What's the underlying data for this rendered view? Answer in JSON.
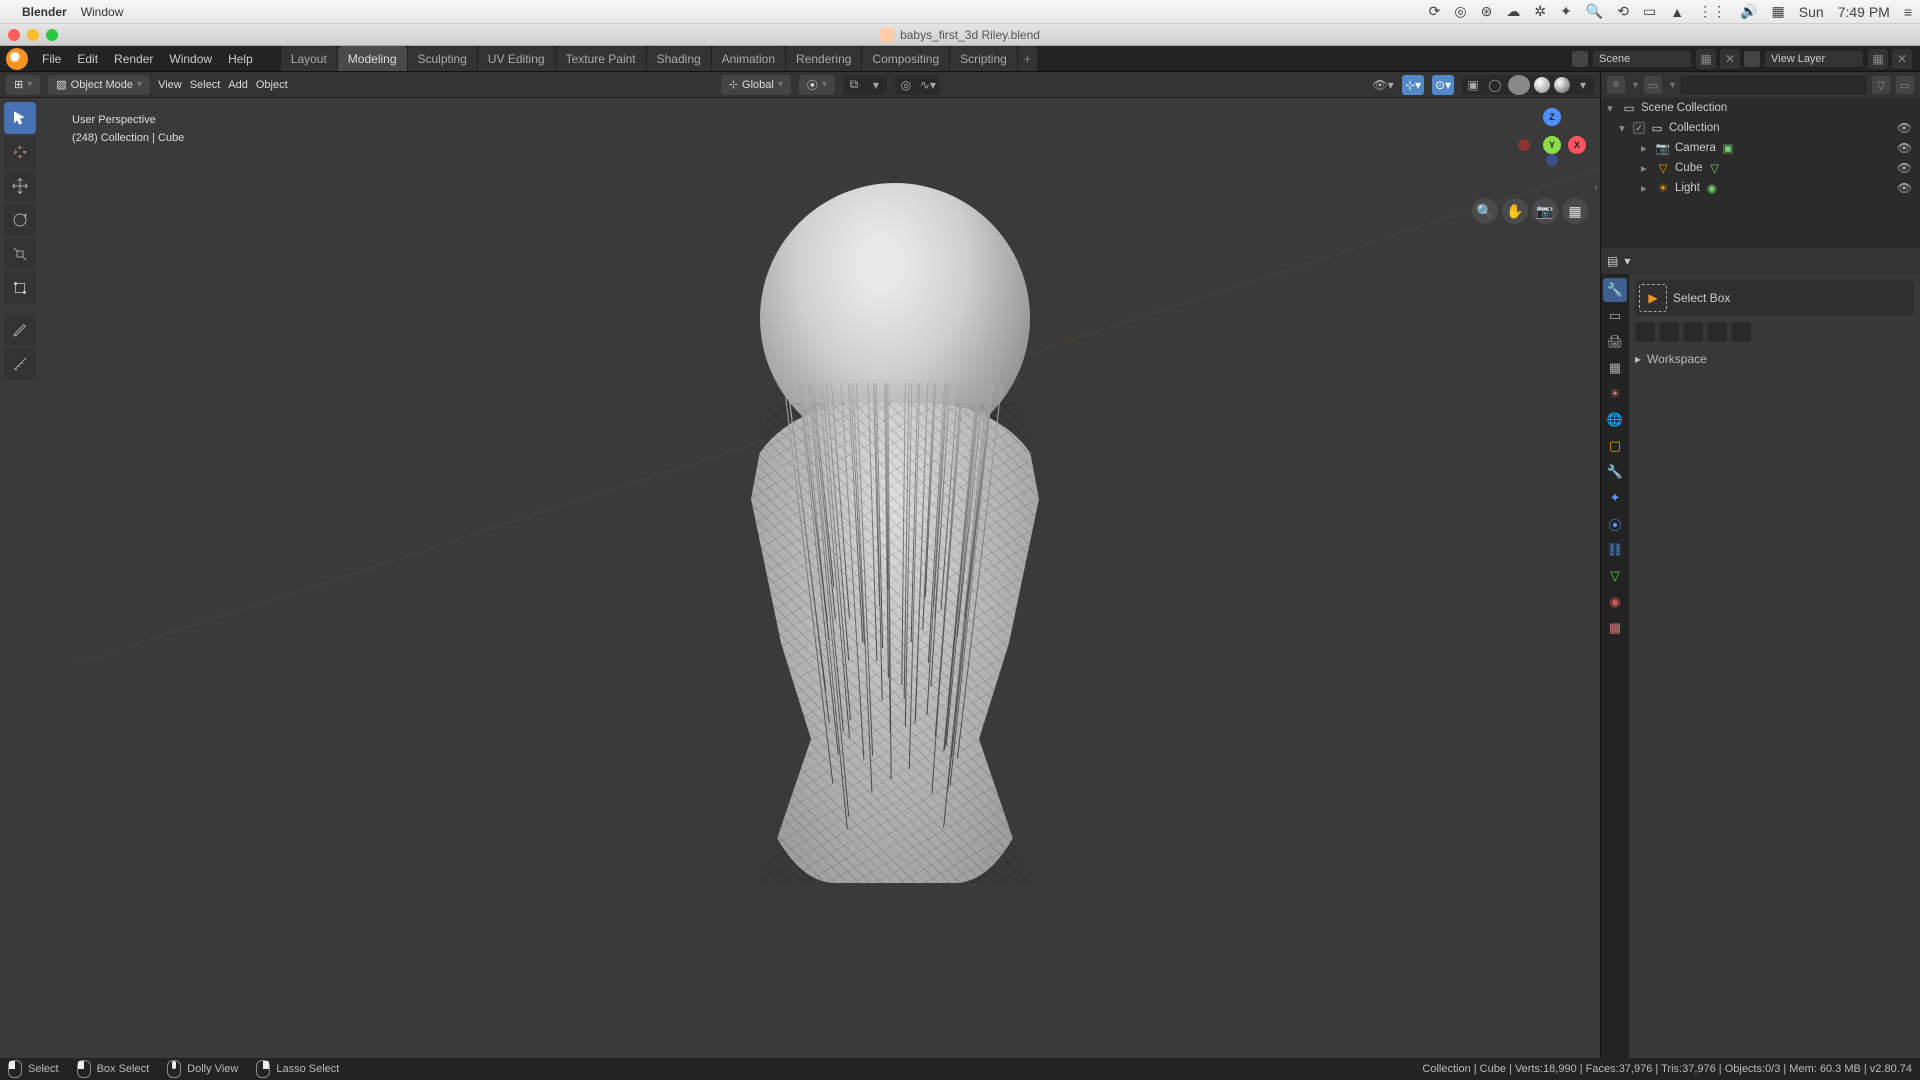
{
  "macos": {
    "app_name": "Blender",
    "menus": [
      "Window"
    ],
    "right_icons": [
      "⟳",
      "◎",
      "⊛",
      "⌘",
      "⎈",
      "✲",
      "⌕",
      "⟲",
      "▭",
      "▲",
      "⋮",
      "🔊",
      "▦"
    ],
    "day": "Sun",
    "time": "7:49 PM"
  },
  "window": {
    "filename": "babys_first_3d Riley.blend"
  },
  "blender_menu": [
    "File",
    "Edit",
    "Render",
    "Window",
    "Help"
  ],
  "workspace_tabs": [
    "Layout",
    "Modeling",
    "Sculpting",
    "UV Editing",
    "Texture Paint",
    "Shading",
    "Animation",
    "Rendering",
    "Compositing",
    "Scripting"
  ],
  "active_tab": "Modeling",
  "scene": {
    "name": "Scene",
    "view_layer": "View Layer"
  },
  "viewport_header": {
    "mode": "Object Mode",
    "menus": [
      "View",
      "Select",
      "Add",
      "Object"
    ],
    "orientation": "Global"
  },
  "overlay": {
    "line1": "User Perspective",
    "line2": "(248) Collection | Cube"
  },
  "outliner": {
    "root": "Scene Collection",
    "collection": "Collection",
    "items": [
      {
        "name": "Camera",
        "type": "camera"
      },
      {
        "name": "Cube",
        "type": "mesh"
      },
      {
        "name": "Light",
        "type": "light"
      }
    ]
  },
  "properties": {
    "active_tool": "Select Box",
    "section": "Workspace"
  },
  "status": {
    "items": [
      "Select",
      "Box Select",
      "Dolly View",
      "Lasso Select"
    ],
    "right": "Collection | Cube | Verts:18,990 | Faces:37,976 | Tris:37,976 | Objects:0/3 | Mem: 60.3 MB | v2.80.74"
  }
}
